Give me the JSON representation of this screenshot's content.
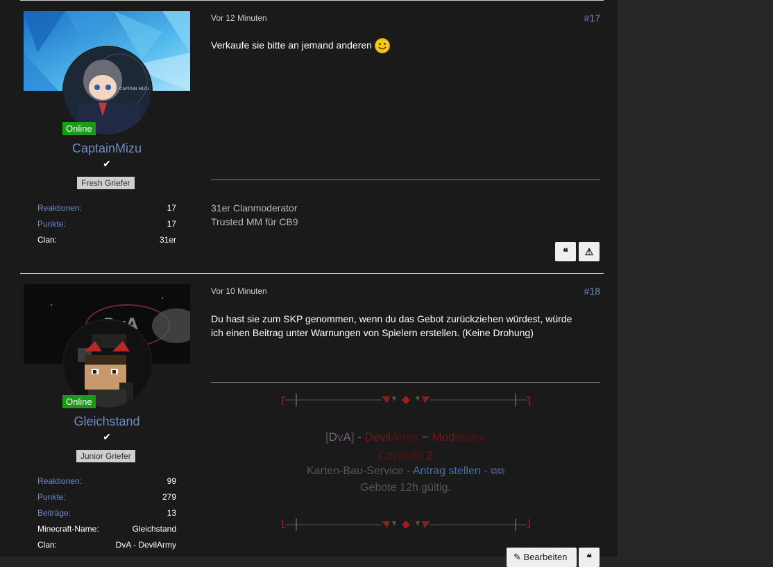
{
  "posts": [
    {
      "time": "Vor 12 Minuten",
      "number": "#17",
      "message": "Verkaufe sie bitte an jemand anderen",
      "online": "Online",
      "username": "CaptainMizu",
      "rank": "Fresh Griefer",
      "avatar_text": "CAPTAIN MIZU",
      "stats": [
        {
          "label": "Reaktionen:",
          "value": "17"
        },
        {
          "label": "Punkte:",
          "value": "17"
        },
        {
          "label": "Clan:",
          "value": "31er"
        }
      ],
      "signature": [
        "31er Clanmoderator",
        "Trusted MM für CB9"
      ],
      "buttons": [
        "quote-icon",
        "warning-icon"
      ]
    },
    {
      "time": "Vor 10 Minuten",
      "number": "#18",
      "message_lines": [
        "Du hast sie zum SKP genommen, wenn du das Gebot zurückziehen würdest, würde",
        "ich einen Beitrag unter Warnungen von Spielern erstellen. (Keine Drohung)"
      ],
      "online": "Online",
      "username": "Gleichstand",
      "rank": "Junior Griefer",
      "stats": [
        {
          "label": "Reaktionen:",
          "value": "99"
        },
        {
          "label": "Punkte:",
          "value": "279"
        },
        {
          "label": "Beiträge:",
          "value": "13"
        },
        {
          "label": "Minecraft-Name:",
          "value": "Gleichstand"
        },
        {
          "label": "Clan:",
          "value": "DvA - DevilArmy"
        }
      ],
      "signature": {
        "line1": {
          "open": "[",
          "d": "D",
          "v": "v",
          "a": "A",
          "close": "]",
          "dash": " - ",
          "devil": "Devil",
          "army": "Army",
          "tilde": " ~ ",
          "mod": "Mod",
          "erator": "erator"
        },
        "line2": {
          "citybuild": "Citybuild",
          "two": "2"
        },
        "line3": {
          "service": "Karten-Bau-Service",
          "dash": " - ",
          "link": "Antrag stellen",
          "dash2": " -"
        },
        "line4": "Gebote 12h gültig."
      },
      "edit_label": "Bearbeiten"
    }
  ]
}
